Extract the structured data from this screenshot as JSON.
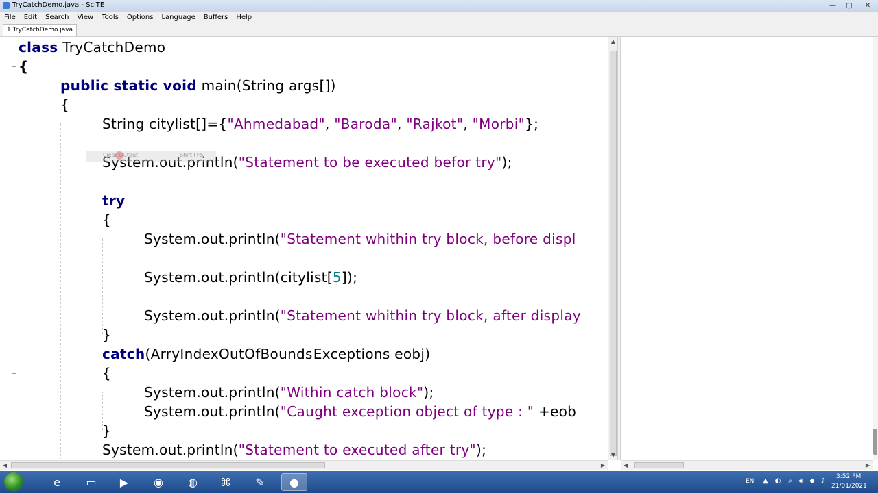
{
  "window": {
    "title": "TryCatchDemo.java - SciTE",
    "controls": {
      "minimize": "—",
      "maximize": "▢",
      "close": "✕"
    }
  },
  "menu": [
    "File",
    "Edit",
    "Search",
    "View",
    "Tools",
    "Options",
    "Language",
    "Buffers",
    "Help"
  ],
  "tabs": [
    {
      "label": "1 TryCatchDemo.java"
    }
  ],
  "tooltip": {
    "text": "Clear Output",
    "shortcut": "Shift+F5"
  },
  "code": {
    "l1_kw": "class",
    "l1_name": " TryCatchDemo",
    "l2": "{",
    "l3_kw": "public static void",
    "l3_rest": " main(String args[])",
    "l4": "{",
    "l5_a": "String citylist[]={",
    "l5_s1": "\"Ahmedabad\"",
    "l5_c1": ", ",
    "l5_s2": "\"Baroda\"",
    "l5_c2": ", ",
    "l5_s3": "\"Rajkot\"",
    "l5_c3": ", ",
    "l5_s4": "\"Morbi\"",
    "l5_end": "};",
    "l7_a": "System.out.println(",
    "l7_s": "\"Statement to be executed befor try\"",
    "l7_end": ");",
    "l9_kw": "try",
    "l10": "{",
    "l11_a": "System.out.println(",
    "l11_s": "\"Statement whithin try block, before displ",
    "l13_a": "System.out.println(citylist[",
    "l13_n": "5",
    "l13_end": "]);",
    "l15_a": "System.out.println(",
    "l15_s": "\"Statement whithin try block, after display",
    "l16": "}",
    "l17_kw": "catch",
    "l17_a": "(ArryIndexOutOfBounds",
    "l17_b": "Exceptions eobj)",
    "l18": "{",
    "l19_a": "System.out.println(",
    "l19_s": "\"Within catch block\"",
    "l19_end": ");",
    "l20_a": "System.out.println(",
    "l20_s": "\"Caught exception object of type : \"",
    "l20_end": " +eob",
    "l21": "}",
    "l22_a": "System.out.println(",
    "l22_s": "\"Statement to executed after try\"",
    "l22_end": ");"
  },
  "taskbar": {
    "apps": [
      "start-orb",
      "ie-icon",
      "explorer-icon",
      "media-icon",
      "chrome-icon",
      "firefox-icon",
      "network-icon",
      "paint-icon",
      "scite-icon"
    ],
    "tray": {
      "lang": "EN",
      "time": "3:52 PM",
      "date": "21/01/2021"
    }
  }
}
